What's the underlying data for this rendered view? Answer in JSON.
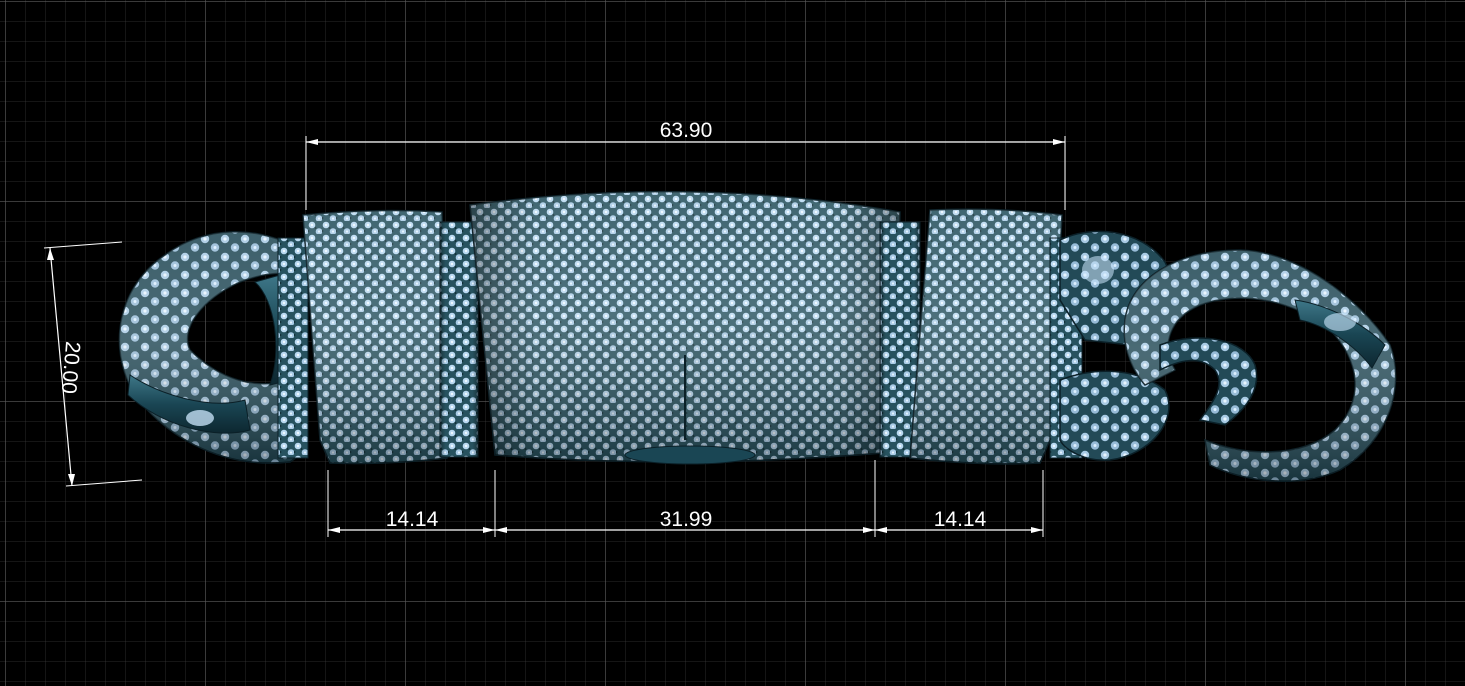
{
  "dimensions": {
    "overall_width": "63.90",
    "height": "20.00",
    "left_segment": "14.14",
    "center_segment": "31.99",
    "right_segment": "14.14"
  },
  "colors": {
    "background": "#000000",
    "grid": "#3a3a3a",
    "metal": "#1c4a58",
    "stone": "#b8d8f0",
    "dimension": "#ffffff"
  }
}
